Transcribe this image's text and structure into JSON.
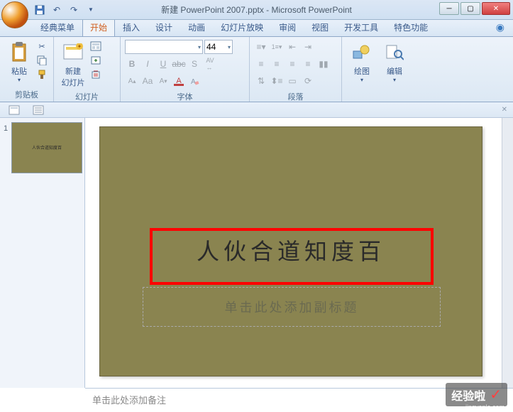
{
  "window": {
    "title": "新建 PowerPoint 2007.pptx - Microsoft PowerPoint"
  },
  "tabs": {
    "classic": "经典菜单",
    "home": "开始",
    "insert": "插入",
    "design": "设计",
    "animation": "动画",
    "slideshow": "幻灯片放映",
    "review": "审阅",
    "view": "视图",
    "developer": "开发工具",
    "special": "特色功能"
  },
  "ribbon": {
    "clipboard": {
      "label": "剪贴板",
      "paste": "粘贴"
    },
    "slides": {
      "label": "幻灯片",
      "new_slide": "新建\n幻灯片"
    },
    "font": {
      "label": "字体",
      "size": "44"
    },
    "paragraph": {
      "label": "段落"
    },
    "drawing": {
      "drawing": "绘图",
      "editing": "编辑"
    }
  },
  "slide": {
    "number": "1",
    "title_text": "人伙合道知度百",
    "subtitle_placeholder": "单击此处添加副标题"
  },
  "notes": {
    "placeholder": "单击此处添加备注"
  },
  "watermark": {
    "text": "经验啦",
    "url": "jingyanla.com"
  }
}
